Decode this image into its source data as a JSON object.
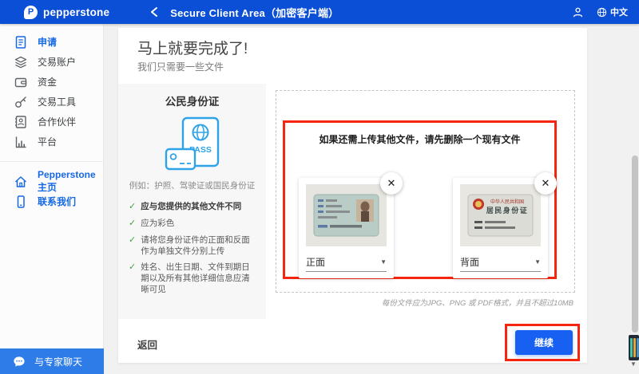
{
  "header": {
    "brand": "pepperstone",
    "title": "Secure Client Area（加密客户端）",
    "language_label": "中文"
  },
  "sidebar": {
    "items": [
      {
        "label": "申请",
        "icon": "document-icon",
        "active": true
      },
      {
        "label": "交易账户",
        "icon": "layers-icon",
        "active": false
      },
      {
        "label": "资金",
        "icon": "wallet-icon",
        "active": false
      },
      {
        "label": "交易工具",
        "icon": "tools-icon",
        "active": false
      },
      {
        "label": "合作伙伴",
        "icon": "partners-icon",
        "active": false
      },
      {
        "label": "平台",
        "icon": "bar-chart-icon",
        "active": false
      }
    ],
    "links": [
      {
        "label": "Pepperstone 主页",
        "icon": "home-icon"
      },
      {
        "label": "联系我们",
        "icon": "phone-icon"
      }
    ],
    "chat_label": "与专家聊天"
  },
  "main": {
    "heading": "马上就要完成了!",
    "subheading": "我们只需要一些文件",
    "document_panel": {
      "title": "公民身份证",
      "icon_label": "PASS",
      "caption": "例如：护照、驾驶证或国民身份证",
      "checklist": [
        "应与您提供的其他文件不同",
        "应为彩色",
        "请将您身份证件的正面和反面作为单独文件分别上传",
        "姓名、出生日期、文件到期日期以及所有其他详细信息应清晰可见"
      ]
    },
    "upload": {
      "warning": "如果还需上传其他文件，请先删除一个现有文件",
      "files": [
        {
          "side": "正面",
          "image": "chinese-id-card-front-photo"
        },
        {
          "side": "背面",
          "image": "chinese-id-card-back-photo",
          "card_line1": "中华人民共和国",
          "card_line2": "居民身份证"
        }
      ],
      "format_note": "每份文件应为JPG、PNG 或 PDF格式，并且不超过10MB"
    },
    "footer": {
      "back": "返回",
      "continue": "继续"
    }
  },
  "colors": {
    "header_blue": "#0b4fd6",
    "accent_blue": "#1668e3",
    "button_blue": "#1860f2",
    "chat_blue": "#2e7ce8",
    "annotation_red": "#f5250f",
    "check_green": "#43a047",
    "passport_icon_blue": "#2fa3e8"
  }
}
